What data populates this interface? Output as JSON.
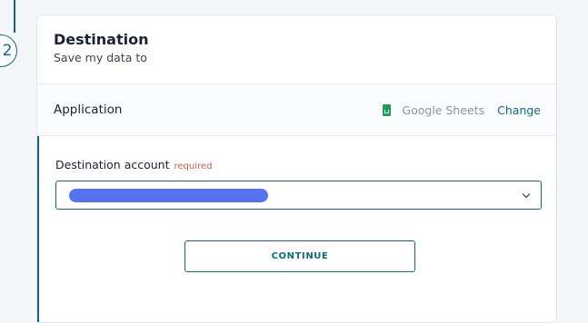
{
  "step": {
    "number": "2"
  },
  "destination": {
    "title": "Destination",
    "subtitle": "Save my data to"
  },
  "application": {
    "label": "Application",
    "icon": "google-sheets-icon",
    "name": "Google Sheets",
    "change_label": "Change"
  },
  "account": {
    "label": "Destination account",
    "required_label": "required",
    "value": ""
  },
  "actions": {
    "continue_label": "CONTINUE"
  },
  "colors": {
    "accent": "#0c6b80",
    "required": "#d55a4a",
    "sheets_green": "#1e9e5a",
    "redaction": "#5573f0"
  }
}
